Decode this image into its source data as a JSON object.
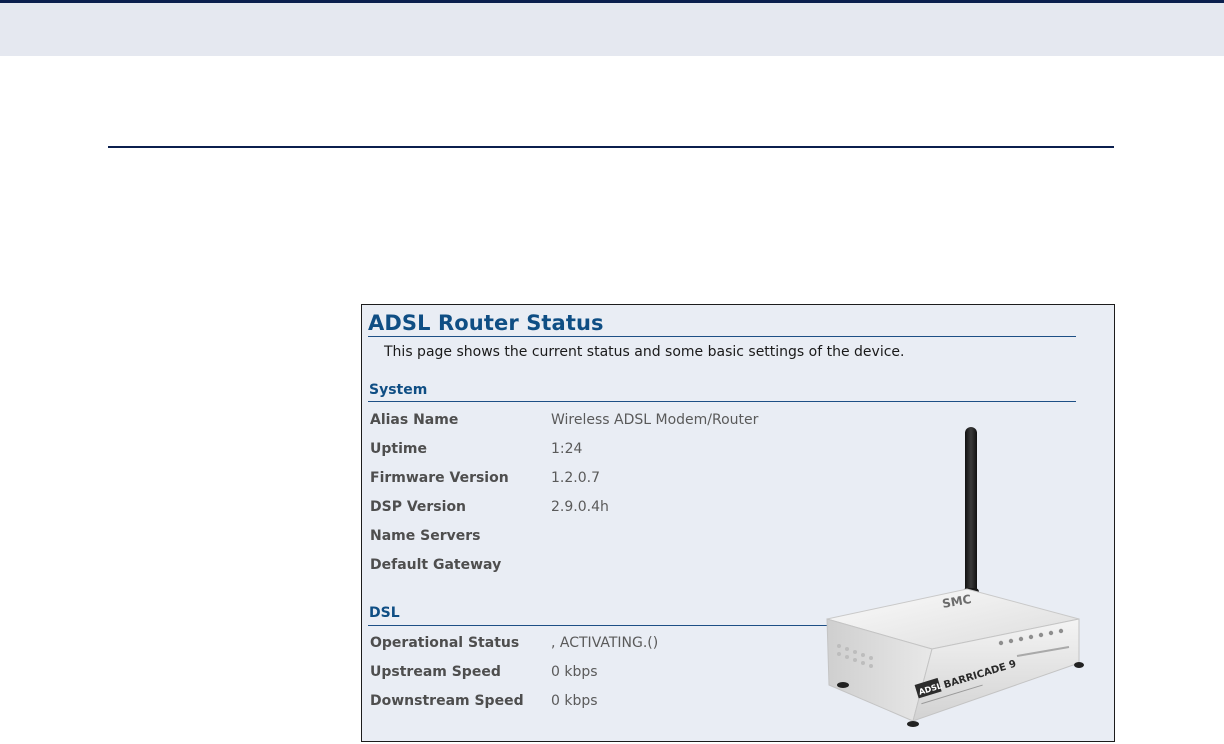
{
  "panel": {
    "title": "ADSL Router Status",
    "description": "This page shows the current status and some basic settings of the device.",
    "system": {
      "heading": "System",
      "rows": [
        {
          "label": "Alias Name",
          "value": "Wireless ADSL Modem/Router"
        },
        {
          "label": "Uptime",
          "value": "1:24"
        },
        {
          "label": "Firmware Version",
          "value": "1.2.0.7"
        },
        {
          "label": "DSP Version",
          "value": "2.9.0.4h"
        },
        {
          "label": "Name Servers",
          "value": ""
        },
        {
          "label": "Default Gateway",
          "value": ""
        }
      ]
    },
    "dsl": {
      "heading": "DSL",
      "rows": [
        {
          "label": "Operational Status",
          "value": ", ACTIVATING.()"
        },
        {
          "label": "Upstream Speed",
          "value": "0 kbps"
        },
        {
          "label": "Downstream Speed",
          "value": "0 kbps"
        }
      ]
    }
  },
  "router_image": {
    "icon": "router-device-image",
    "brand_text": "SMC",
    "model_text": "BARRICADE 9",
    "adsl_text": "ADSL"
  },
  "colors": {
    "title": "#0f4e84",
    "panel_bg": "#e9edf4",
    "top_band": "#e5e8f0",
    "rule": "#0b1f4e"
  }
}
